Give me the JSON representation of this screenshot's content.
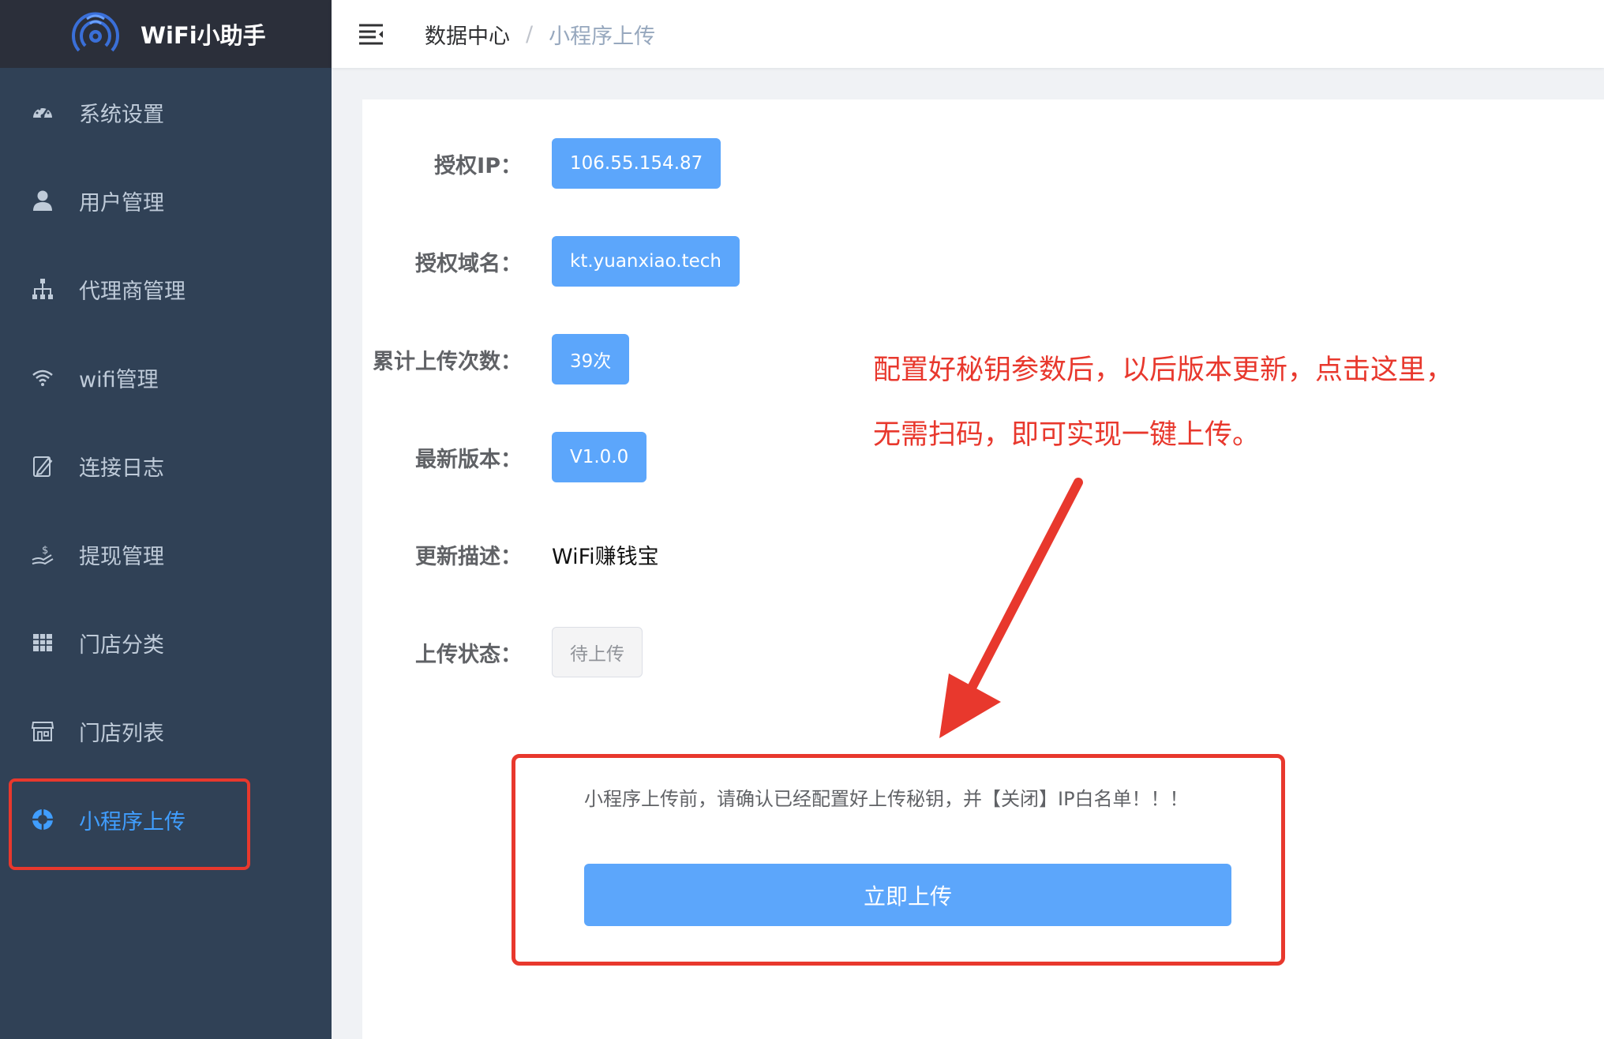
{
  "app": {
    "title": "WiFi小助手"
  },
  "sidebar": {
    "items": [
      {
        "label": "系统设置",
        "icon": "dashboard-icon"
      },
      {
        "label": "用户管理",
        "icon": "user-icon"
      },
      {
        "label": "代理商管理",
        "icon": "org-tree-icon"
      },
      {
        "label": "wifi管理",
        "icon": "wifi-icon"
      },
      {
        "label": "连接日志",
        "icon": "log-edit-icon"
      },
      {
        "label": "提现管理",
        "icon": "withdraw-icon"
      },
      {
        "label": "门店分类",
        "icon": "grid-icon"
      },
      {
        "label": "门店列表",
        "icon": "store-icon"
      },
      {
        "label": "小程序上传",
        "icon": "miniprogram-icon",
        "active": true
      }
    ]
  },
  "header": {
    "breadcrumb": {
      "home": "数据中心",
      "separator": "/",
      "current": "小程序上传"
    }
  },
  "form": {
    "ip": {
      "label": "授权IP：",
      "value": "106.55.154.87"
    },
    "domain": {
      "label": "授权域名：",
      "value": "kt.yuanxiao.tech"
    },
    "upload_count": {
      "label": "累计上传次数：",
      "value": "39次"
    },
    "version": {
      "label": "最新版本：",
      "value": "V1.0.0"
    },
    "description": {
      "label": "更新描述：",
      "value": "WiFi赚钱宝"
    },
    "status": {
      "label": "上传状态：",
      "value": "待上传"
    }
  },
  "annotation": {
    "line1": "配置好秘钥参数后，以后版本更新，点击这里，",
    "line2": "无需扫码，即可实现一键上传。"
  },
  "notice": {
    "text": "小程序上传前，请确认已经配置好上传秘钥，并【关闭】IP白名单！！！",
    "button_label": "立即上传"
  },
  "colors": {
    "sidebar_bg": "#304156",
    "logo_bg": "#2b2f3a",
    "accent": "#409eff",
    "tag_blue": "#5ca6fb",
    "annotation_red": "#e8382d"
  }
}
